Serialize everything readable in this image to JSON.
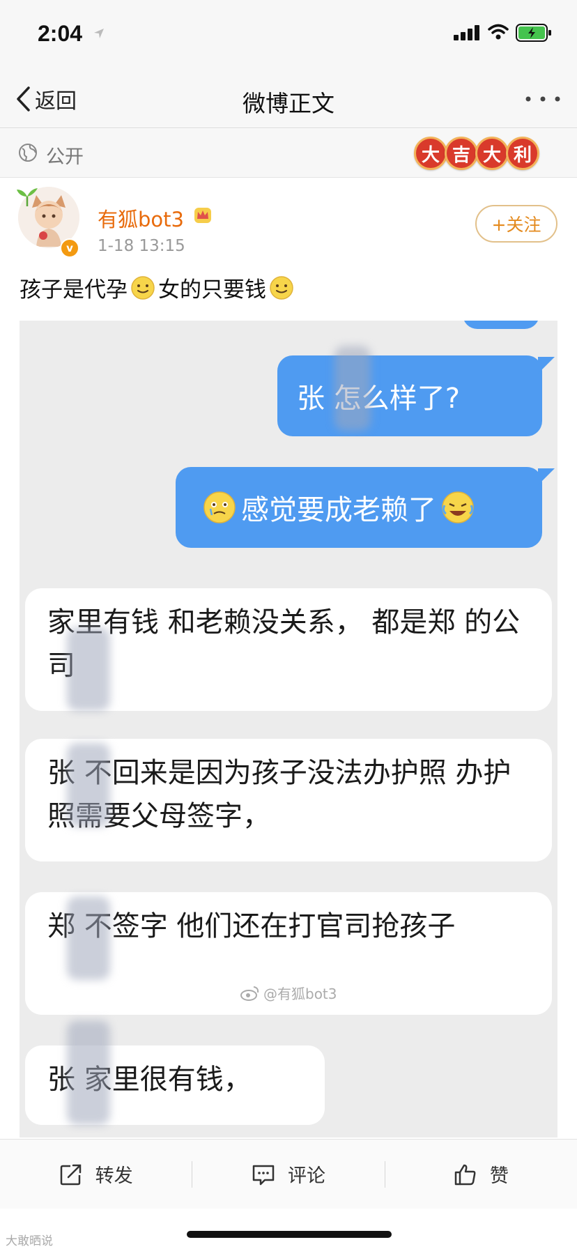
{
  "status": {
    "time": "2:04"
  },
  "nav": {
    "back_label": "返回",
    "title": "微博正文"
  },
  "visibility": {
    "label": "公开"
  },
  "badges": [
    "大",
    "吉",
    "大",
    "利"
  ],
  "post": {
    "username": "有狐bot3",
    "time": "1-18 13:15",
    "follow_label": "+关注",
    "verified_mark": "v",
    "text_part1": "孩子是代孕",
    "text_part2": "女的只要钱"
  },
  "chat": {
    "msg1": "张   怎么样了?",
    "msg2": "感觉要成老赖了",
    "msg3": "家里有钱 和老赖没关系，   都是郑   的公司",
    "msg4": "张   不回来是因为孩子没法办护照 办护照需要父母签字，",
    "msg5": "郑   不签字 他们还在打官司抢孩子",
    "msg6": "张   家里很有钱，",
    "watermark": "@有狐bot3"
  },
  "toolbar": {
    "repost": "转发",
    "comment": "评论",
    "like": "赞"
  },
  "footer": {
    "corner_mark": "大敢晒说"
  },
  "colors": {
    "accent_orange": "#e86b0c",
    "bubble_blue": "#4f9bf1",
    "badge_red": "#d93a2b"
  }
}
